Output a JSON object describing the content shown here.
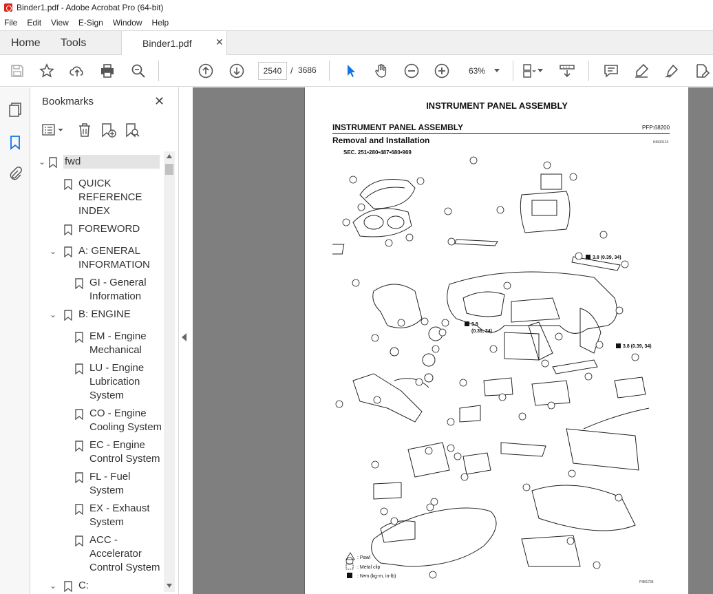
{
  "window": {
    "title": "Binder1.pdf - Adobe Acrobat Pro (64-bit)"
  },
  "menu": [
    "File",
    "Edit",
    "View",
    "E-Sign",
    "Window",
    "Help"
  ],
  "tabs": {
    "home": "Home",
    "tools": "Tools",
    "document": "Binder1.pdf"
  },
  "toolbar": {
    "page_current": "2540",
    "page_separator": "/",
    "page_total": "3686",
    "zoom": "63%"
  },
  "bookmarks": {
    "title": "Bookmarks",
    "items": [
      {
        "label": "fwd",
        "level": 0,
        "expanded": true,
        "selected": true
      },
      {
        "label": "QUICK\nREFERENCE\nINDEX",
        "level": 1
      },
      {
        "label": "FOREWORD",
        "level": 1
      },
      {
        "label": "A: GENERAL\nINFORMATION",
        "level": 1,
        "expanded": true
      },
      {
        "label": "GI - General\nInformation",
        "level": 2
      },
      {
        "label": "B: ENGINE",
        "level": 1,
        "expanded": true
      },
      {
        "label": "EM - Engine\nMechanical",
        "level": 2
      },
      {
        "label": "LU - Engine\nLubrication\nSystem",
        "level": 2
      },
      {
        "label": "CO - Engine\nCooling System",
        "level": 2
      },
      {
        "label": "EC - Engine\nControl System",
        "level": 2
      },
      {
        "label": "FL - Fuel\nSystem",
        "level": 2
      },
      {
        "label": "EX - Exhaust\nSystem",
        "level": 2
      },
      {
        "label": "ACC -\nAccelerator\nControl System",
        "level": 2
      },
      {
        "label": "C:",
        "level": 1,
        "expanded": true
      }
    ]
  },
  "page": {
    "header": "INSTRUMENT PANEL ASSEMBLY",
    "section": "INSTRUMENT PANEL ASSEMBLY",
    "pfp": "PFP:68200",
    "subtitle": "Removal and Installation",
    "code": "NIS00124",
    "sec": "SEC. 251•280•487•680•969",
    "torque1": "3.8 (0.39, 34)",
    "torque2a": "3.8",
    "torque2b": "(0.39, 34)",
    "torque3": "3.8 (0.39, 34)",
    "legend_pawl": ": Pawl",
    "legend_clip": ": Metal clip",
    "legend_torque": ": N•m  (kg-m,  in-lb)",
    "footer": "PIIB1735"
  }
}
